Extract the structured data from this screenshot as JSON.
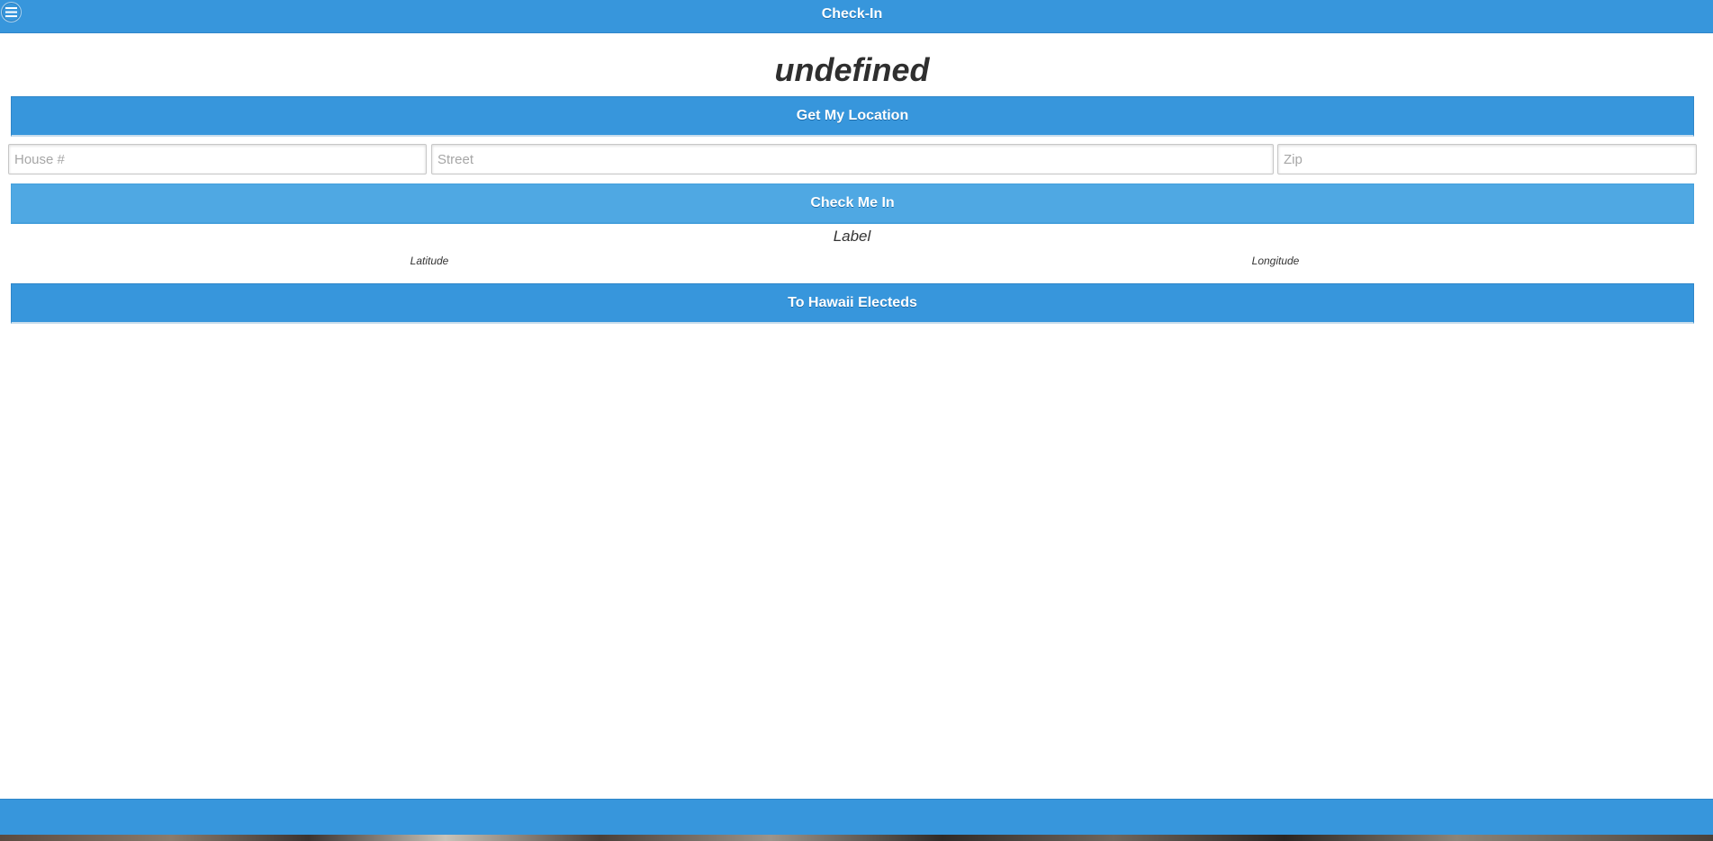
{
  "header": {
    "title": "Check-In",
    "menu_icon": "hamburger-menu-icon"
  },
  "main": {
    "heading": "undefined",
    "get_location_label": "Get My Location",
    "inputs": {
      "house_placeholder": "House #",
      "street_placeholder": "Street",
      "zip_placeholder": "Zip"
    },
    "check_in_label": "Check Me In",
    "status_label": "Label",
    "latitude_label": "Latitude",
    "longitude_label": "Longitude",
    "to_electeds_label": "To Hawaii Electeds"
  },
  "colors": {
    "accent": "#3796dc",
    "accent_light": "#4fa8e3"
  }
}
